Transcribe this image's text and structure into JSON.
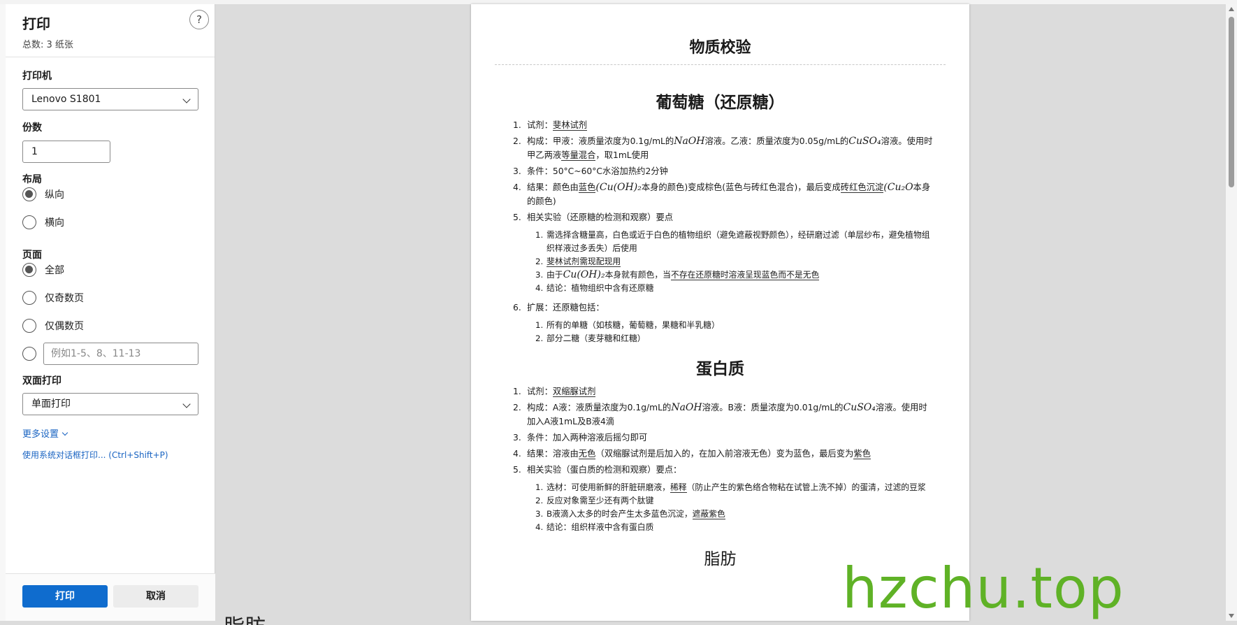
{
  "backdrop": {
    "partial_text": "脂肪"
  },
  "panel": {
    "title": "打印",
    "subtitle": "总数: 3 纸张",
    "help_label": "?",
    "printer": {
      "label": "打印机",
      "value": "Lenovo S1801"
    },
    "copies": {
      "label": "份数",
      "value": "1"
    },
    "layout": {
      "label": "布局",
      "options": [
        "纵向",
        "横向"
      ],
      "selected": "纵向"
    },
    "pages": {
      "label": "页面",
      "options": [
        "全部",
        "仅奇数页",
        "仅偶数页"
      ],
      "selected": "全部",
      "custom_placeholder": "例如1-5、8、11-13"
    },
    "duplex": {
      "label": "双面打印",
      "value": "单面打印"
    },
    "more_settings": "更多设置",
    "system_dialog": "使用系统对话框打印... (Ctrl+Shift+P)",
    "print_button": "打印",
    "cancel_button": "取消"
  },
  "preview": {
    "doc_title": "物质校验",
    "sections": {
      "glucose": {
        "heading": "葡萄糖（还原糖）",
        "i1": {
          "num": "1.",
          "pre": "试剂：",
          "u": "斐林试剂"
        },
        "i2": {
          "num": "2.",
          "a": "构成：甲液：液质量浓度为0.1g/mL的",
          "m1": "NaOH",
          "b": "溶液。乙液：质量浓度为0.05g/mL的",
          "m2": "CuSO₄",
          "c": "溶液。使用时甲乙两液",
          "u": "等量混合",
          "d": "，取1mL使用"
        },
        "i3": {
          "num": "3.",
          "text": "条件：50°C~60°C水浴加热约2分钟"
        },
        "i4": {
          "num": "4.",
          "a": "结果：颜色由",
          "u1": "蓝色",
          "m1": "(Cu(OH)₂",
          "b": "本身的颜色)变成棕色(蓝色与砖红色混合)，最后变成",
          "u2": "砖红色沉淀",
          "m2": "(Cu₂O",
          "c": "本身的颜色)"
        },
        "i5": {
          "num": "5.",
          "text": "相关实验（还原糖的检测和观察）要点"
        },
        "i5_sub": [
          {
            "num": "1.",
            "text": "需选择含糖量高，白色或近于白色的植物组织（避免遮蔽视野颜色），经研磨过滤（单层纱布，避免植物组织样液过多丢失）后使用"
          },
          {
            "num": "2.",
            "text": "斐林试剂需现配现用"
          },
          {
            "num": "3.",
            "a": "由于",
            "m": "Cu(OH)₂",
            "b": "本身就有颜色，当",
            "u": "不存在还原糖时溶液呈现蓝色而不是无色"
          },
          {
            "num": "4.",
            "text": "结论：植物组织中含有还原糖"
          }
        ],
        "i6": {
          "num": "6.",
          "text": "扩展：还原糖包括："
        },
        "i6_sub": [
          {
            "num": "1.",
            "text": "所有的单糖（如核糖，葡萄糖，果糖和半乳糖）"
          },
          {
            "num": "2.",
            "text": "部分二糖（麦芽糖和红糖）"
          }
        ]
      },
      "protein": {
        "heading": "蛋白质",
        "i1": {
          "num": "1.",
          "pre": "试剂：",
          "u": "双缩脲试剂"
        },
        "i2": {
          "num": "2.",
          "a": "构成：A液：液质量浓度为0.1g/mL的",
          "m1": "NaOH",
          "b": "溶液。B液：质量浓度为0.01g/mL的",
          "m2": "CuSO₄",
          "c": "溶液。使用时加入A液1mL及B液4滴"
        },
        "i3": {
          "num": "3.",
          "text": "条件：加入两种溶液后摇匀即可"
        },
        "i4": {
          "num": "4.",
          "a": "结果：溶液由",
          "u1": "无色",
          "b": "（双缩脲试剂是后加入的，在加入前溶液无色）变为蓝色，最后变为",
          "u2": "紫色"
        },
        "i5": {
          "num": "5.",
          "text": "相关实验（蛋白质的检测和观察）要点："
        },
        "i5_sub": [
          {
            "num": "1.",
            "a": "选材：可使用新鲜的肝脏研磨液，",
            "u": "稀释",
            "b": "（防止产生的紫色络合物粘在试管上洗不掉）的蛋清，过滤的豆浆"
          },
          {
            "num": "2.",
            "text": "反应对象需至少还有两个肽键"
          },
          {
            "num": "3.",
            "a": "B液滴入太多的时会产生太多蓝色沉淀，",
            "u": "遮蔽紫色"
          },
          {
            "num": "4.",
            "text": "结论：组织样液中含有蛋白质"
          }
        ]
      },
      "fat": {
        "heading": "脂肪"
      }
    }
  },
  "watermark": "hzchu.top"
}
